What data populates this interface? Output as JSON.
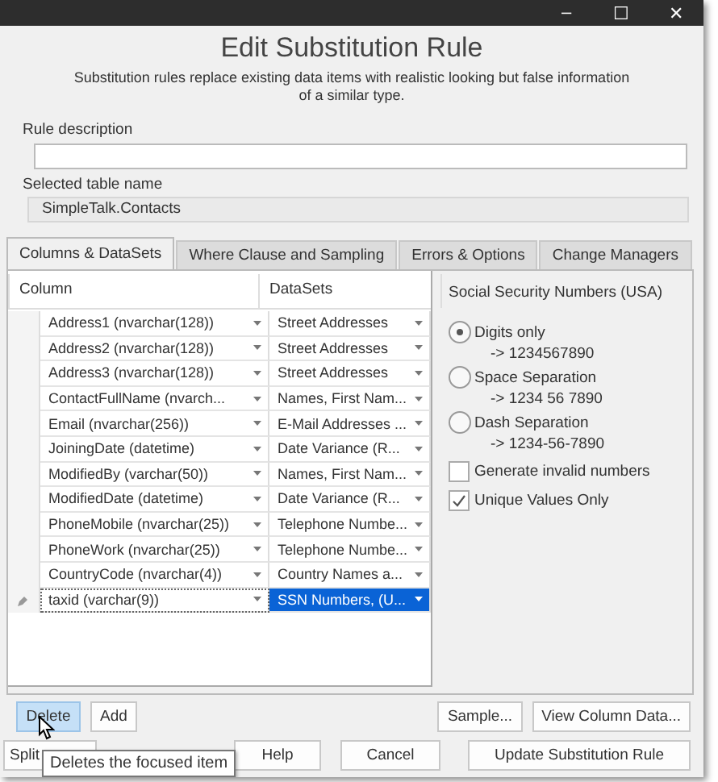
{
  "window": {
    "title_bar_buttons": [
      "–",
      "☐",
      "✕"
    ]
  },
  "heading": "Edit Substitution Rule",
  "description": "Substitution rules replace existing data items with realistic looking but false information of a similar type.",
  "rule_description": {
    "label": "Rule description"
  },
  "table_name": {
    "label": "Selected table name",
    "value": "SimpleTalk.Contacts"
  },
  "tabs": [
    {
      "label": "Columns & DataSets",
      "selected": true
    },
    {
      "label": "Where Clause and Sampling",
      "selected": false
    },
    {
      "label": "Errors & Options",
      "selected": false
    },
    {
      "label": "Change Managers",
      "selected": false
    }
  ],
  "grid": {
    "columns": [
      "Column",
      "DataSets"
    ],
    "rows": [
      {
        "column": "Address1 (nvarchar(128))",
        "dataset": "Street Addresses",
        "selected": false
      },
      {
        "column": "Address2 (nvarchar(128))",
        "dataset": "Street Addresses",
        "selected": false
      },
      {
        "column": "Address3 (nvarchar(128))",
        "dataset": "Street Addresses",
        "selected": false
      },
      {
        "column": "ContactFullName (nvarch...",
        "dataset": "Names, First Nam...",
        "selected": false
      },
      {
        "column": "Email (nvarchar(256))",
        "dataset": "E-Mail Addresses ...",
        "selected": false
      },
      {
        "column": "JoiningDate (datetime)",
        "dataset": "Date Variance (R...",
        "selected": false
      },
      {
        "column": "ModifiedBy (varchar(50))",
        "dataset": "Names, First Nam...",
        "selected": false
      },
      {
        "column": "ModifiedDate (datetime)",
        "dataset": "Date Variance (R...",
        "selected": false
      },
      {
        "column": "PhoneMobile (nvarchar(25))",
        "dataset": "Telephone Numbe...",
        "selected": false
      },
      {
        "column": "PhoneWork (nvarchar(25))",
        "dataset": "Telephone Numbe...",
        "selected": false
      },
      {
        "column": "CountryCode (nvarchar(4))",
        "dataset": "Country Names a...",
        "selected": false
      },
      {
        "column": "taxid (varchar(9))",
        "dataset": "SSN Numbers, (U...",
        "selected": true
      }
    ]
  },
  "options": {
    "title": "Social Security Numbers (USA)",
    "formats": [
      {
        "label": "Digits only",
        "example": "-> 1234567890",
        "selected": true
      },
      {
        "label": "Space Separation",
        "example": "-> 1234 56 7890",
        "selected": false
      },
      {
        "label": "Dash Separation",
        "example": "-> 1234-56-7890",
        "selected": false
      }
    ],
    "checkboxes": [
      {
        "label": "Generate invalid numbers",
        "checked": false
      },
      {
        "label": "Unique Values Only",
        "checked": true
      }
    ]
  },
  "grid_buttons": [
    {
      "label": "Delete",
      "hovered": true
    },
    {
      "label": "Add",
      "hovered": false
    }
  ],
  "panel_buttons": [
    "Sample...",
    "View Column Data..."
  ],
  "footer_buttons": [
    "Split",
    "Help",
    "Cancel",
    "Update Substitution Rule"
  ],
  "tooltip": "Deletes the focused item"
}
